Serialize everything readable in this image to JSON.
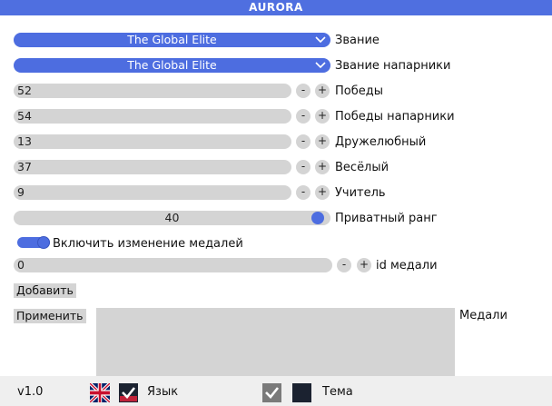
{
  "window": {
    "title": "AURORA"
  },
  "rank": {
    "value": "The Global Elite",
    "label": "Звание"
  },
  "teammate_rank": {
    "value": "The Global Elite",
    "label": "Звание напарники"
  },
  "steppers": [
    {
      "value": "52",
      "label": "Победы"
    },
    {
      "value": "54",
      "label": "Победы напарники"
    },
    {
      "value": "13",
      "label": "Дружелюбный"
    },
    {
      "value": "37",
      "label": "Весёлый"
    },
    {
      "value": "9",
      "label": "Учитель"
    }
  ],
  "stepper_buttons": {
    "minus": "-",
    "plus": "+"
  },
  "private_rank": {
    "value": "40",
    "label": "Приватный ранг",
    "level_fraction": 0.96
  },
  "medal_toggle": {
    "checked": true,
    "label": "Включить изменение медалей"
  },
  "medal_id": {
    "value": "0",
    "label": "id медали"
  },
  "buttons": {
    "add": "Добавить",
    "apply": "Применить"
  },
  "medals": {
    "label": "Медали"
  },
  "footer": {
    "version": "v1.0",
    "language_label": "Язык",
    "theme_label": "Тема"
  },
  "colors": {
    "accent": "#4d6de0",
    "titlebar": "#4f6fe0",
    "field": "#d4d4d4",
    "theme_swatch": "#1b2230"
  },
  "icons": {
    "language": "uk-flag-icon",
    "dropdown": "chevron-down-icon",
    "checkbox": "checkmark-icon"
  }
}
